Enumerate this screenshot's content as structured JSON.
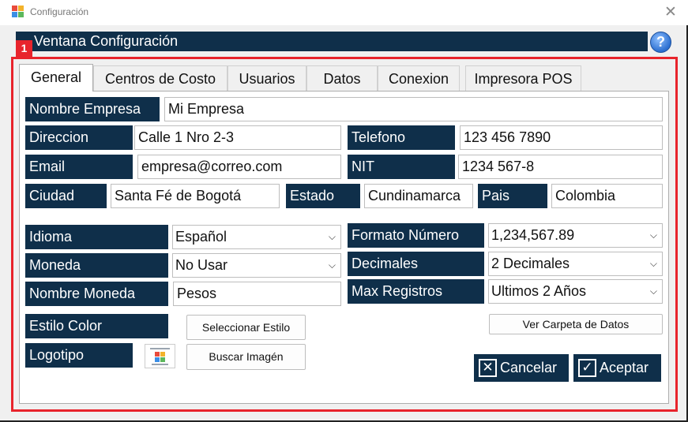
{
  "window": {
    "title": "Configuración",
    "close_glyph": "✕"
  },
  "header": {
    "title": "Ventana Configuración",
    "help_label": "?"
  },
  "annotation": {
    "badge": "1"
  },
  "tabs": [
    {
      "label": "General",
      "active": true
    },
    {
      "label": "Centros de Costo",
      "active": false
    },
    {
      "label": "Usuarios",
      "active": false
    },
    {
      "label": "Datos",
      "active": false
    },
    {
      "label": "Conexion",
      "active": false
    },
    {
      "label": "Impresora POS",
      "active": false
    }
  ],
  "form": {
    "company_name": {
      "label": "Nombre Empresa",
      "value": "Mi Empresa"
    },
    "address": {
      "label": "Direccion",
      "value": "Calle 1 Nro 2-3"
    },
    "phone": {
      "label": "Telefono",
      "value": "123 456 7890"
    },
    "email": {
      "label": "Email",
      "value": "empresa@correo.com"
    },
    "nit": {
      "label": "NIT",
      "value": "1234 567-8"
    },
    "city": {
      "label": "Ciudad",
      "value": "Santa Fé de Bogotá"
    },
    "state": {
      "label": "Estado",
      "value": "Cundinamarca"
    },
    "country": {
      "label": "Pais",
      "value": "Colombia"
    },
    "language": {
      "label": "Idioma",
      "value": "Español"
    },
    "number_format": {
      "label": "Formato Número",
      "value": "1,234,567.89"
    },
    "currency": {
      "label": "Moneda",
      "value": "No Usar"
    },
    "decimals": {
      "label": "Decimales",
      "value": "2 Decimales"
    },
    "currency_name": {
      "label": "Nombre Moneda",
      "value": "Pesos"
    },
    "max_records": {
      "label": "Max Registros",
      "value": "Ultimos 2 Años"
    },
    "color_style": {
      "label": "Estilo Color",
      "button": "Seleccionar Estilo"
    },
    "logo": {
      "label": "Logotipo",
      "button": "Buscar Imagén"
    },
    "data_folder_button": "Ver Carpeta de Datos"
  },
  "actions": {
    "cancel": "Cancelar",
    "accept": "Aceptar"
  },
  "icons": {
    "app": "app-logo-icon",
    "help": "help-icon",
    "cancel": "cancel-x-icon",
    "accept": "checkmark-icon",
    "dropdown": "chevron-down-icon"
  },
  "colors": {
    "label_bg": "#0f2f4a",
    "highlight": "#e8242c",
    "help": "#2c6fd0"
  }
}
